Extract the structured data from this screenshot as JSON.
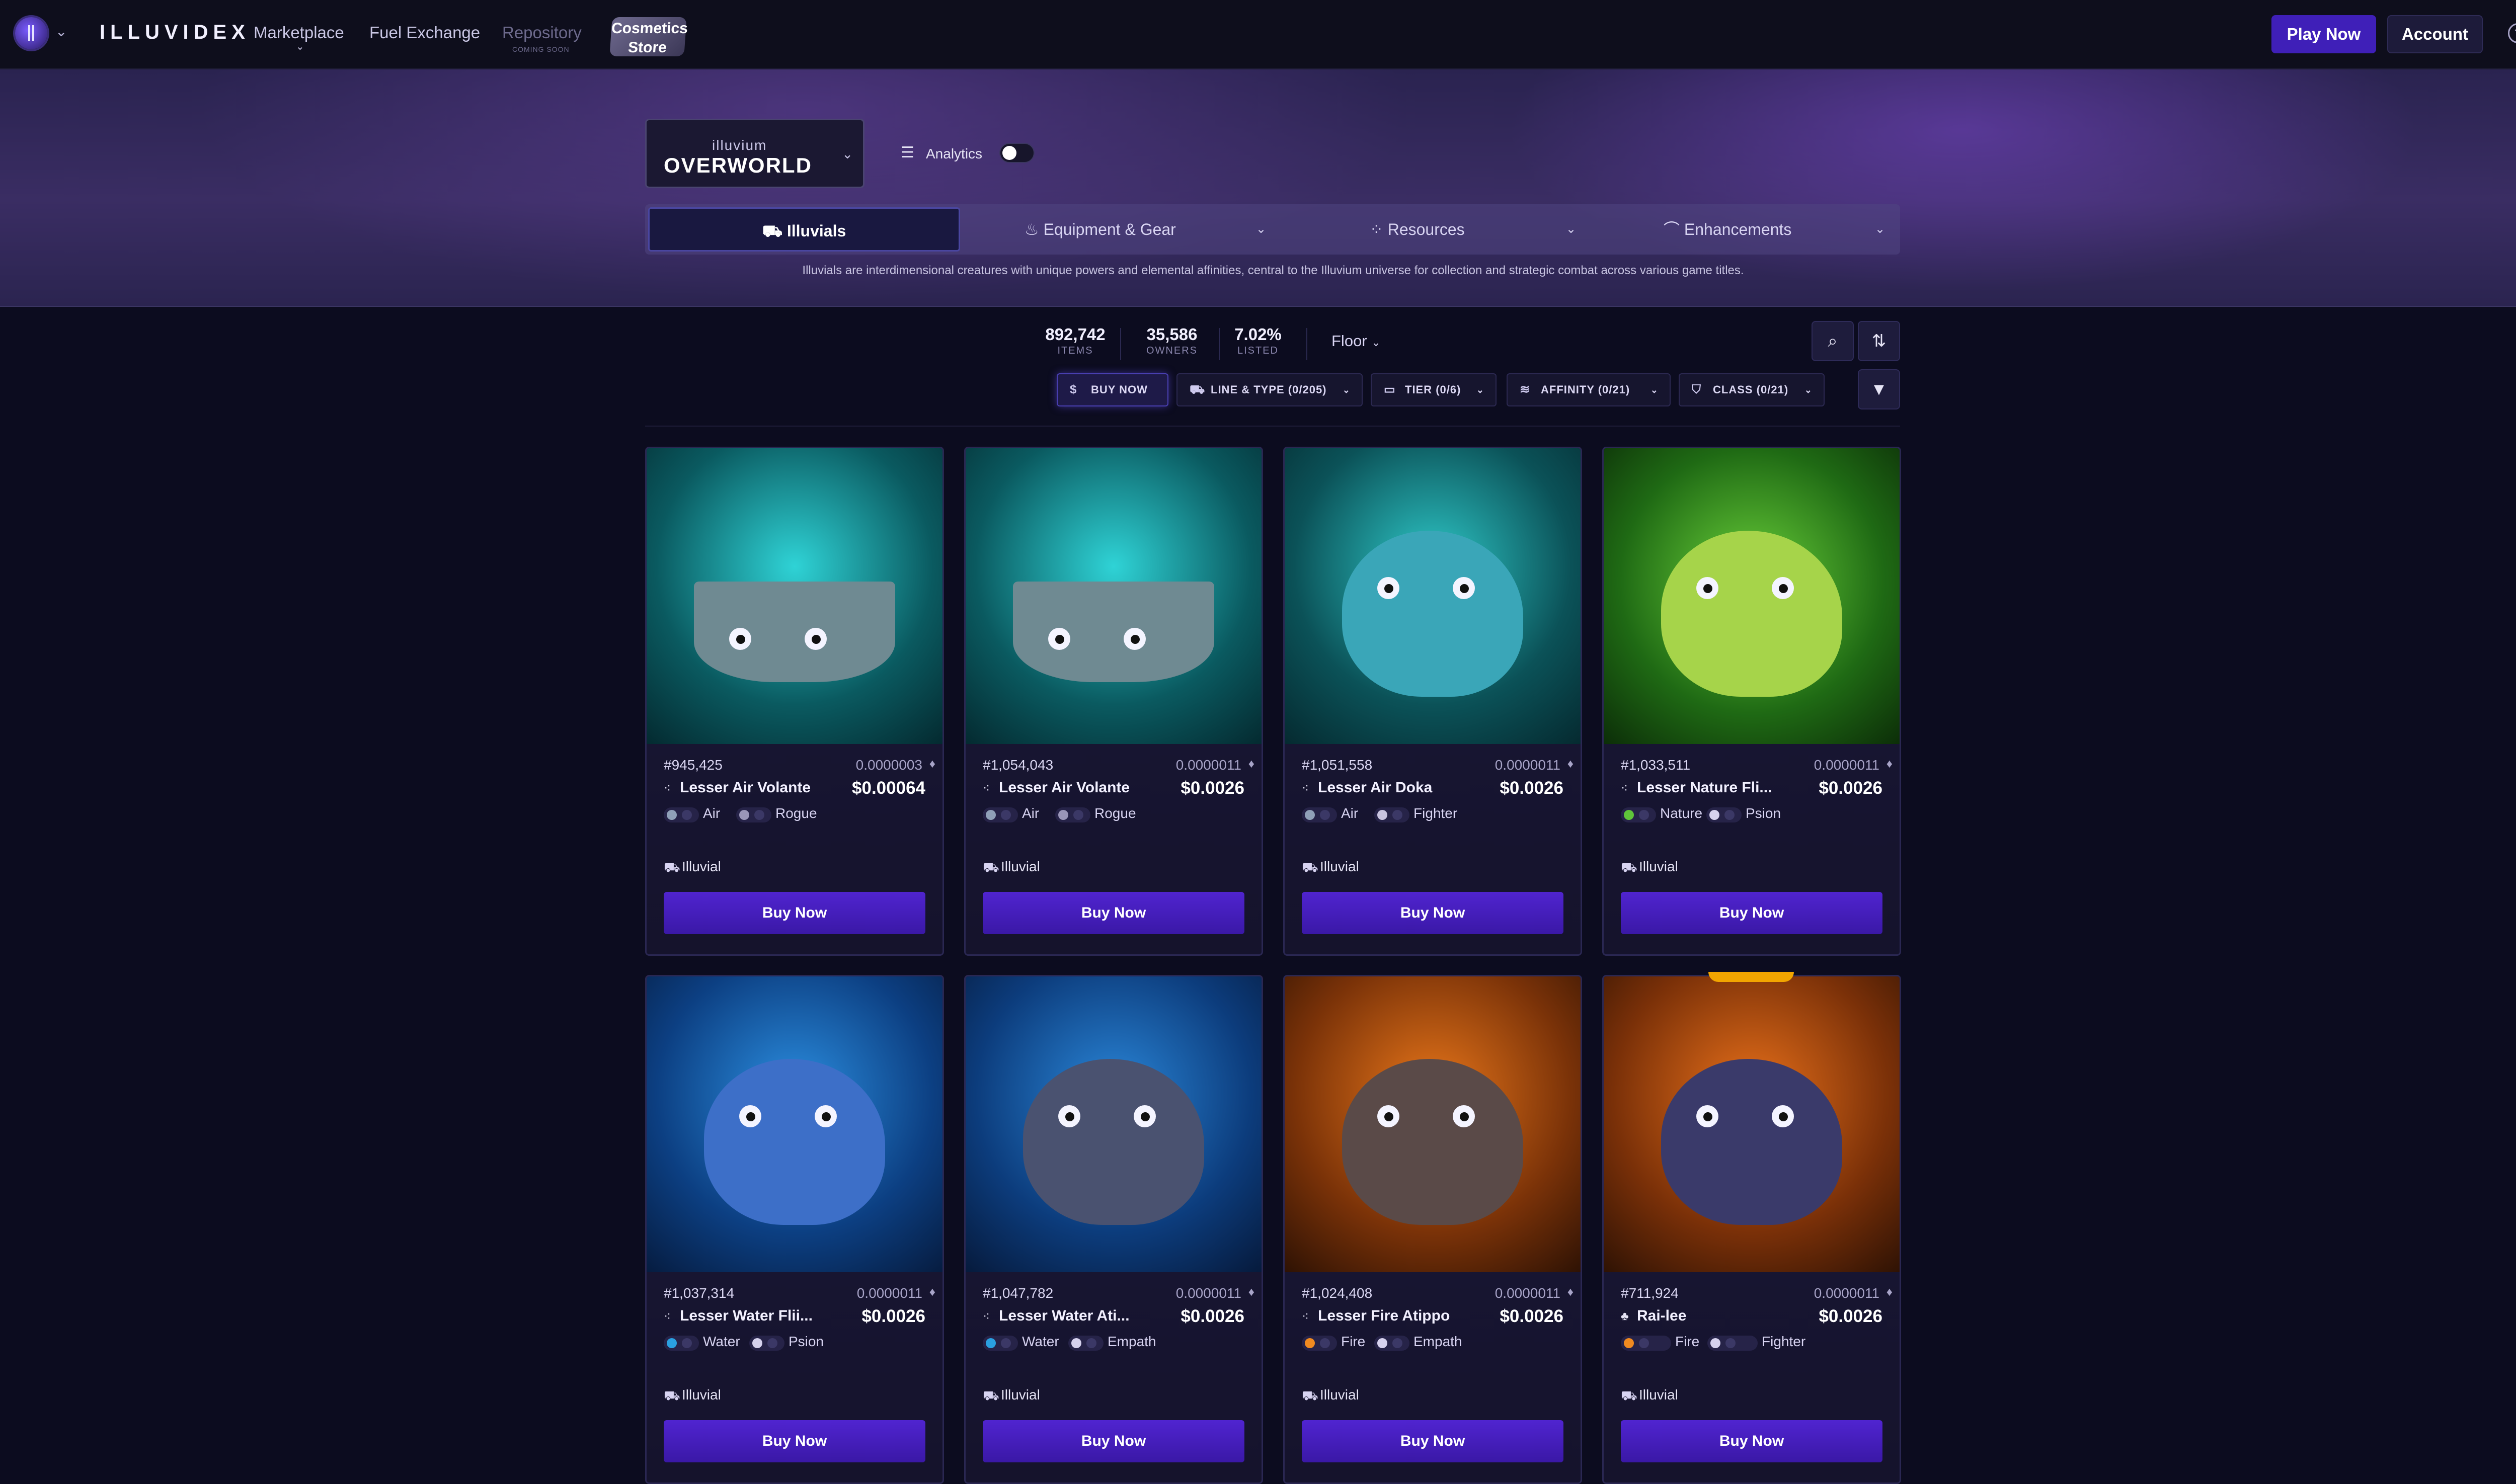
{
  "nav": {
    "brand": "ILLUVIDEX",
    "links": [
      "Marketplace",
      "Fuel Exchange",
      "Repository"
    ],
    "repository_sub": "COMING SOON",
    "cosmetics_line1": "Cosmetics",
    "cosmetics_line2": "Store",
    "play_now": "Play Now",
    "account": "Account"
  },
  "hero": {
    "game_small": "illuvium",
    "game_name": "OVERWORLD",
    "analytics_label": "Analytics",
    "tabs": [
      "Illuvials",
      "Equipment & Gear",
      "Resources",
      "Enhancements"
    ],
    "description": "Illuvials are interdimensional creatures with unique powers and elemental affinities, central to the Illuvium universe for collection and strategic combat across various game titles."
  },
  "stats": [
    {
      "value": "892,742",
      "label": "ITEMS"
    },
    {
      "value": "35,586",
      "label": "OWNERS"
    },
    {
      "value": "7.02%",
      "label": "LISTED"
    }
  ],
  "sort": {
    "label": "Floor"
  },
  "filters": [
    {
      "label": "BUY NOW"
    },
    {
      "label": "LINE & TYPE (0/205)"
    },
    {
      "label": "TIER (0/6)"
    },
    {
      "label": "AFFINITY (0/21)"
    },
    {
      "label": "CLASS (0/21)"
    }
  ],
  "colors": {
    "accent": "#3f1fb8",
    "air": "#8fa0b8",
    "nature": "#5fc43a",
    "water": "#2aa0e0",
    "fire": "#f08a20"
  },
  "cards": [
    {
      "id": "#945,425",
      "eth": "0.0000003",
      "name": "Lesser Air Volante",
      "usd": "$0.00064",
      "affinity": "Air",
      "klass": "Rogue",
      "type": "Illuvial",
      "buy": "Buy Now"
    },
    {
      "id": "#1,054,043",
      "eth": "0.0000011",
      "name": "Lesser Air Volante",
      "usd": "$0.0026",
      "affinity": "Air",
      "klass": "Rogue",
      "type": "Illuvial",
      "buy": "Buy Now"
    },
    {
      "id": "#1,051,558",
      "eth": "0.0000011",
      "name": "Lesser Air Doka",
      "usd": "$0.0026",
      "affinity": "Air",
      "klass": "Fighter",
      "type": "Illuvial",
      "buy": "Buy Now"
    },
    {
      "id": "#1,033,511",
      "eth": "0.0000011",
      "name": "Lesser Nature Fli...",
      "usd": "$0.0026",
      "affinity": "Nature",
      "klass": "Psion",
      "type": "Illuvial",
      "buy": "Buy Now"
    },
    {
      "id": "#1,037,314",
      "eth": "0.0000011",
      "name": "Lesser Water Flii...",
      "usd": "$0.0026",
      "affinity": "Water",
      "klass": "Psion",
      "type": "Illuvial",
      "buy": "Buy Now"
    },
    {
      "id": "#1,047,782",
      "eth": "0.0000011",
      "name": "Lesser Water Ati...",
      "usd": "$0.0026",
      "affinity": "Water",
      "klass": "Empath",
      "type": "Illuvial",
      "buy": "Buy Now"
    },
    {
      "id": "#1,024,408",
      "eth": "0.0000011",
      "name": "Lesser Fire Atippo",
      "usd": "$0.0026",
      "affinity": "Fire",
      "klass": "Empath",
      "type": "Illuvial",
      "buy": "Buy Now"
    },
    {
      "id": "#711,924",
      "eth": "0.0000011",
      "name": "Rai-lee",
      "usd": "$0.0026",
      "affinity": "Fire",
      "klass": "Fighter",
      "type": "Illuvial",
      "buy": "Buy Now"
    }
  ]
}
